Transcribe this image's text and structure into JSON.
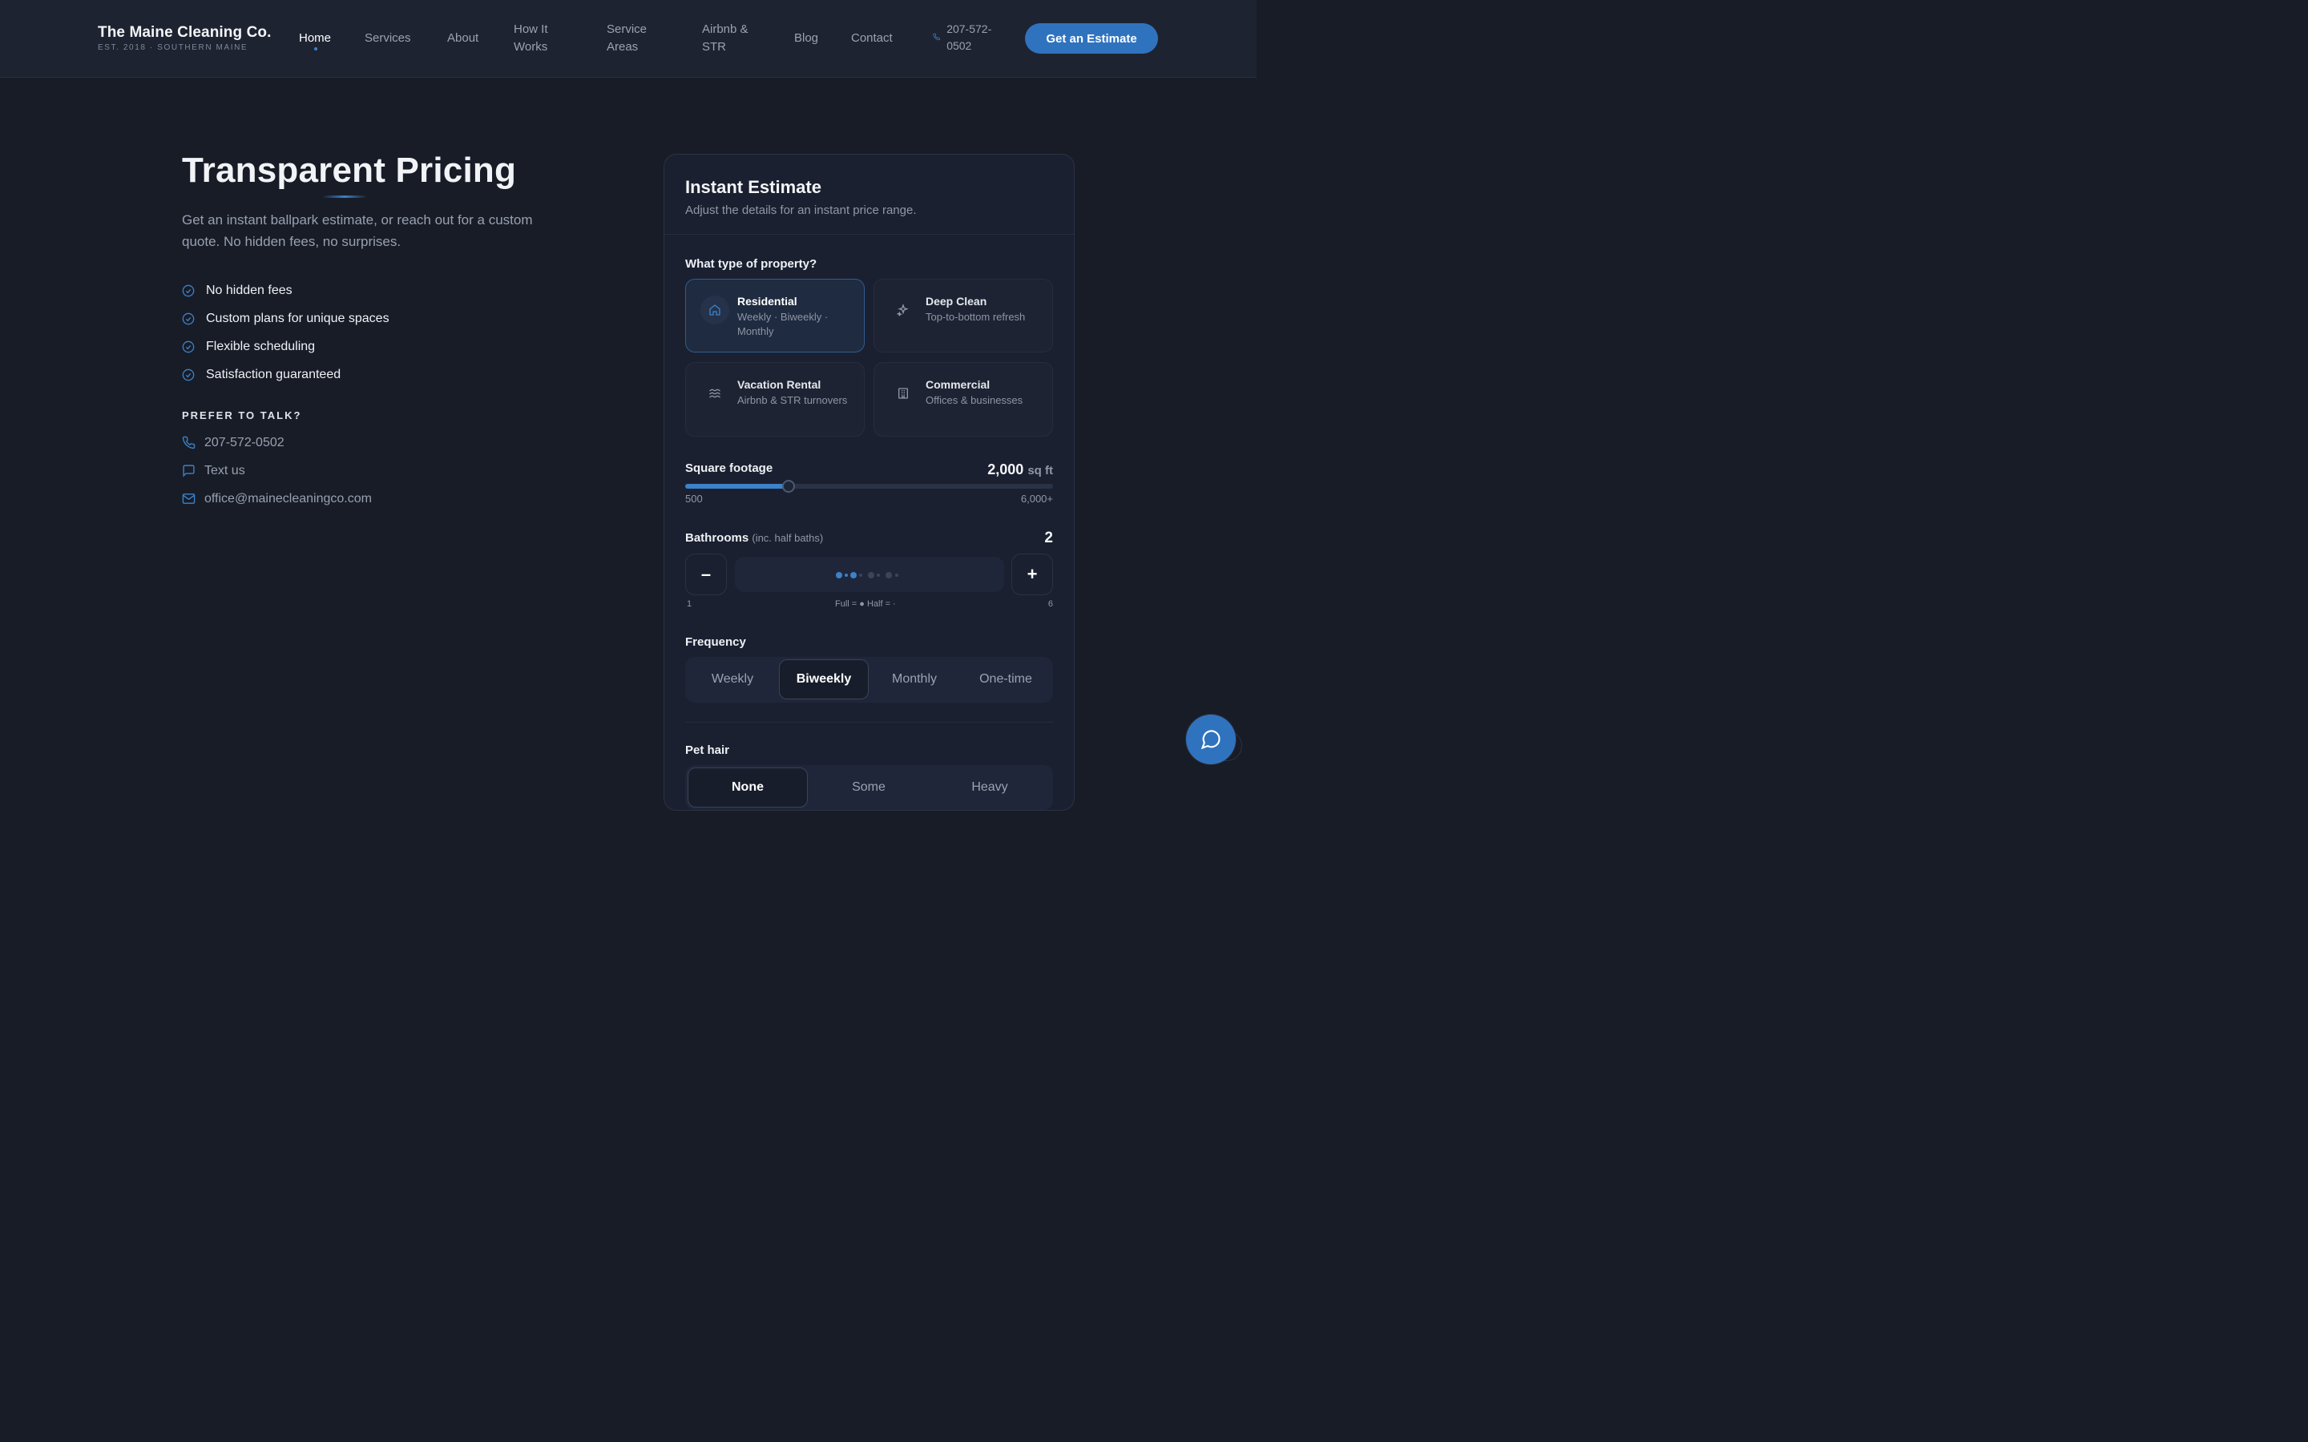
{
  "header": {
    "brand_name": "The Maine Cleaning Co.",
    "brand_sub": "EST. 2018 · SOUTHERN MAINE",
    "nav": {
      "home": "Home",
      "services": "Services",
      "about": "About",
      "how": "How It Works",
      "areas": "Service Areas",
      "airbnb": "Airbnb & STR",
      "blog": "Blog",
      "contact": "Contact"
    },
    "active_nav": "Home",
    "phone": "207-572-0502",
    "cta": "Get an Estimate"
  },
  "hero": {
    "title": "Transparent Pricing",
    "subtitle": "Get an instant ballpark estimate, or reach out for a custom quote. No hidden fees, no surprises.",
    "features": [
      "No hidden fees",
      "Custom plans for unique spaces",
      "Flexible scheduling",
      "Satisfaction guaranteed"
    ],
    "talk_label": "PREFER TO TALK?",
    "contact_phone": "207-572-0502",
    "contact_text": "Text us",
    "contact_email": "office@mainecleaningco.com"
  },
  "estimate": {
    "title": "Instant Estimate",
    "subtitle": "Adjust the details for an instant price range.",
    "property_label": "What type of property?",
    "property_types": [
      {
        "title": "Residential",
        "desc": "Weekly · Biweekly · Monthly",
        "icon": "home-icon",
        "selected": true
      },
      {
        "title": "Deep Clean",
        "desc": "Top-to-bottom refresh",
        "icon": "sparkle-icon",
        "selected": false
      },
      {
        "title": "Vacation Rental",
        "desc": "Airbnb & STR turnovers",
        "icon": "waves-icon",
        "selected": false
      },
      {
        "title": "Commercial",
        "desc": "Offices & businesses",
        "icon": "building-icon",
        "selected": false
      }
    ],
    "sqft_label": "Square footage",
    "sqft_value": "2,000",
    "sqft_unit": "sq ft",
    "sqft_min": "500",
    "sqft_max": "6,000+",
    "sqft_fill_fraction": 0.28,
    "bath_label": "Bathrooms",
    "bath_note": "(inc. half baths)",
    "bath_value": "2",
    "bath_min": "1",
    "bath_max": "6",
    "bath_legend": "Full = ●  Half = ·",
    "frequency_label": "Frequency",
    "frequency_options": [
      "Weekly",
      "Biweekly",
      "Monthly",
      "One-time"
    ],
    "frequency_selected": "Biweekly",
    "pet_label": "Pet hair",
    "pet_options": [
      "None",
      "Some",
      "Heavy"
    ],
    "pet_selected": "None"
  },
  "colors": {
    "accent": "#3b82c8",
    "background": "#181c27",
    "header_bg": "#1e2331",
    "card_bg": "#1b2030"
  }
}
